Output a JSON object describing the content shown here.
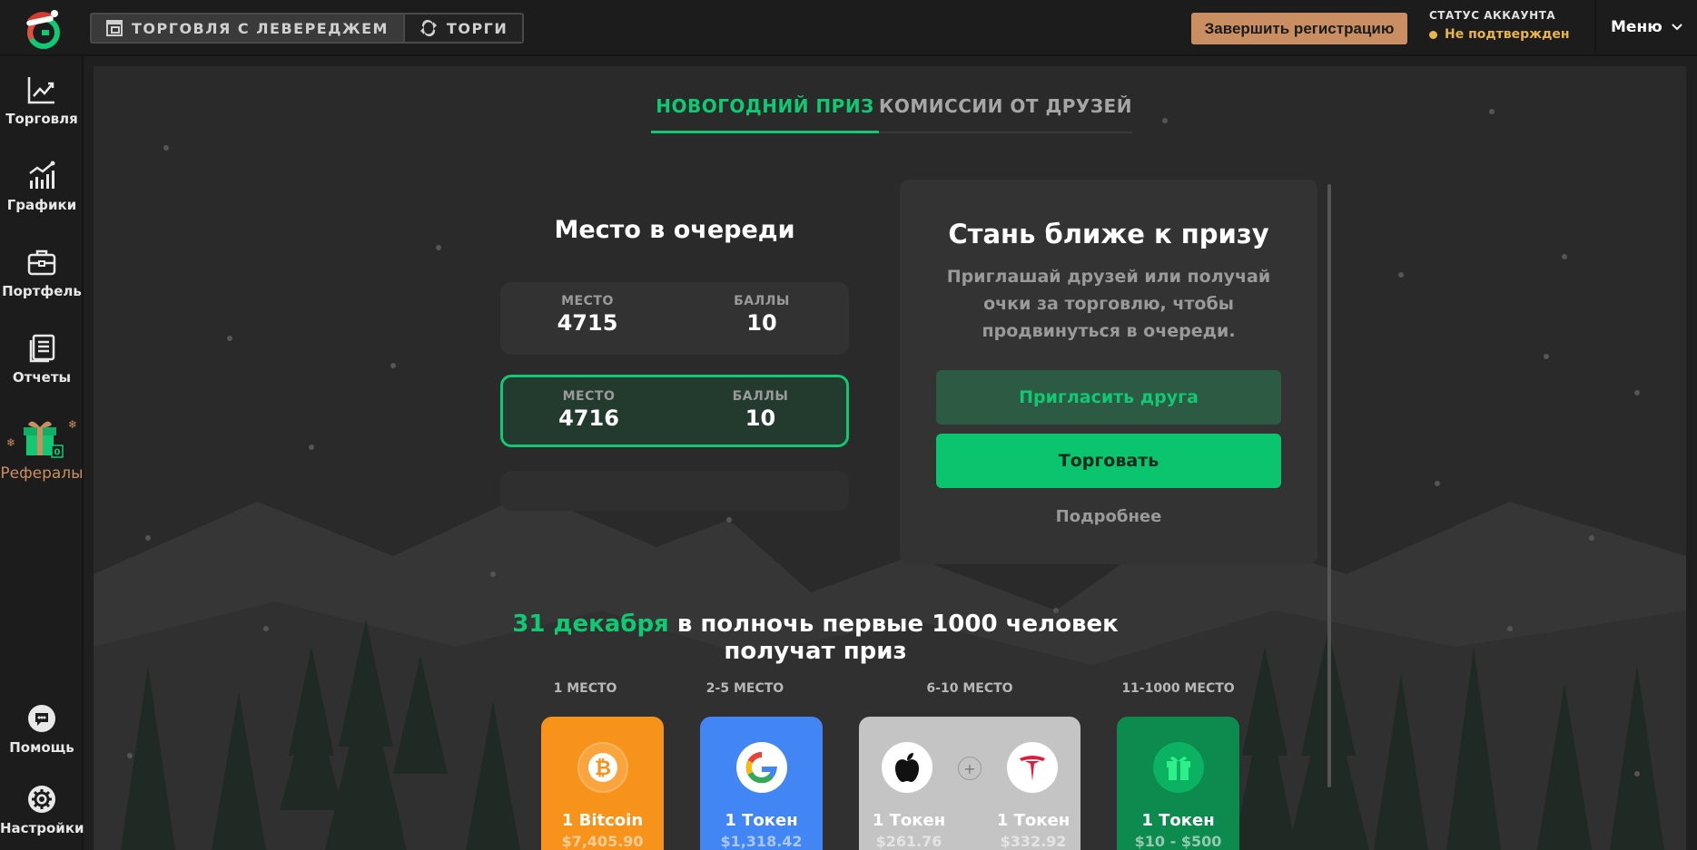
{
  "topbar": {
    "modes": [
      "ТОРГОВЛЯ С ЛЕВЕРЕДЖЕМ",
      "ТОРГИ"
    ],
    "finish_registration": "Завершить регистрацию",
    "account_status_label": "СТАТУС АККАУНТА",
    "account_status_value": "Не подтвержден",
    "menu_label": "Меню"
  },
  "sidebar": {
    "items": [
      {
        "label": "Торговля",
        "icon": "chart-line-icon"
      },
      {
        "label": "Графики",
        "icon": "bar-chart-icon"
      },
      {
        "label": "Портфель",
        "icon": "briefcase-icon"
      },
      {
        "label": "Отчеты",
        "icon": "document-icon"
      },
      {
        "label": "Рефералы",
        "icon": "gift-icon",
        "badge": "0"
      }
    ],
    "bottom_items": [
      {
        "label": "Помощь",
        "icon": "chat-icon"
      },
      {
        "label": "Настройки",
        "icon": "gear-icon"
      }
    ]
  },
  "tabs": [
    "НОВОГОДНИЙ ПРИЗ",
    "КОМИССИИ ОТ ДРУЗЕЙ"
  ],
  "queue": {
    "title": "Место в очереди",
    "place_label": "МЕСТО",
    "points_label": "БАЛЛЫ",
    "rows": [
      {
        "place": "4715",
        "points": "10"
      },
      {
        "place": "4716",
        "points": "10"
      }
    ]
  },
  "promo": {
    "title": "Стань ближе к призу",
    "text": "Приглашай друзей или получай очки за торговлю, чтобы продвинуться в очереди.",
    "invite_button": "Пригласить друга",
    "trade_button": "Торговать",
    "more_link": "Подробнее"
  },
  "headline": {
    "date": "31 декабря",
    "rest": " в полночь первые 1000 человек получат приз"
  },
  "prizes": [
    {
      "place": "1 МЕСТО",
      "items": [
        {
          "amount": "1 Bitcoin",
          "usd": "$7,405.90",
          "icon": "bitcoin-icon"
        }
      ],
      "color": "#f7931a"
    },
    {
      "place": "2-5 МЕСТО",
      "items": [
        {
          "amount": "1 Токен",
          "usd": "$1,318.42",
          "icon": "google-icon"
        }
      ],
      "color": "#4285f4"
    },
    {
      "place": "6-10 МЕСТО",
      "items": [
        {
          "amount": "1 Токен",
          "usd": "$261.76",
          "icon": "apple-icon"
        },
        {
          "amount": "1 Токен",
          "usd": "$332.92",
          "icon": "tesla-icon"
        }
      ],
      "plus": "+",
      "color": "#c4c4c4"
    },
    {
      "place": "11-1000 МЕСТО",
      "items": [
        {
          "amount": "1 Токен",
          "usd": "$10 - $500",
          "icon": "gift-icon"
        }
      ],
      "color": "#0d8a4e"
    }
  ],
  "colors": {
    "accent": "#10c972",
    "orange": "#c98e62",
    "status": "#e9b44c"
  }
}
